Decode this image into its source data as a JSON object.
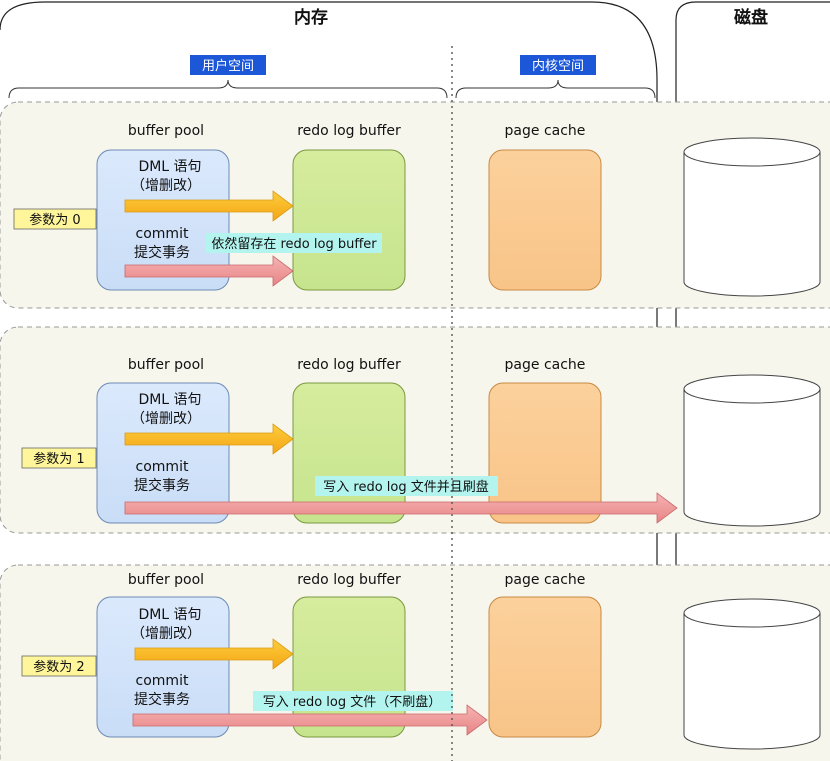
{
  "memory": {
    "title": "内存"
  },
  "disk": {
    "title": "磁盘"
  },
  "user_space": {
    "label": "用户空间"
  },
  "kernel_space": {
    "label": "内核空间"
  },
  "column_labels": {
    "buffer_pool": "buffer pool",
    "redo_log_buffer": "redo log buffer",
    "page_cache": "page cache"
  },
  "ops": {
    "dml_line1": "DML 语句",
    "dml_line2": "（增删改）",
    "commit_line1": "commit",
    "commit_line2": "提交事务"
  },
  "rows": [
    {
      "param": "参数为 0",
      "annotation": "依然留存在 redo log buffer"
    },
    {
      "param": "参数为 1",
      "annotation": "写入 redo log 文件并且刷盘"
    },
    {
      "param": "参数为 2",
      "annotation": "写入 redo log 文件（不刷盘）"
    }
  ],
  "colors": {
    "panel_bg": "#f7f6ed",
    "buffer_pool": "#d6e6fb",
    "redo_log_buffer": "#cfe898",
    "page_cache": "#fbcb94",
    "badge_fill": "#fff59a",
    "header_badge": "#1b57d6",
    "dml_arrow": "#f8b61a",
    "commit_arrow": "#ef9a9b",
    "annotation_bg": "#b4f4ee"
  }
}
